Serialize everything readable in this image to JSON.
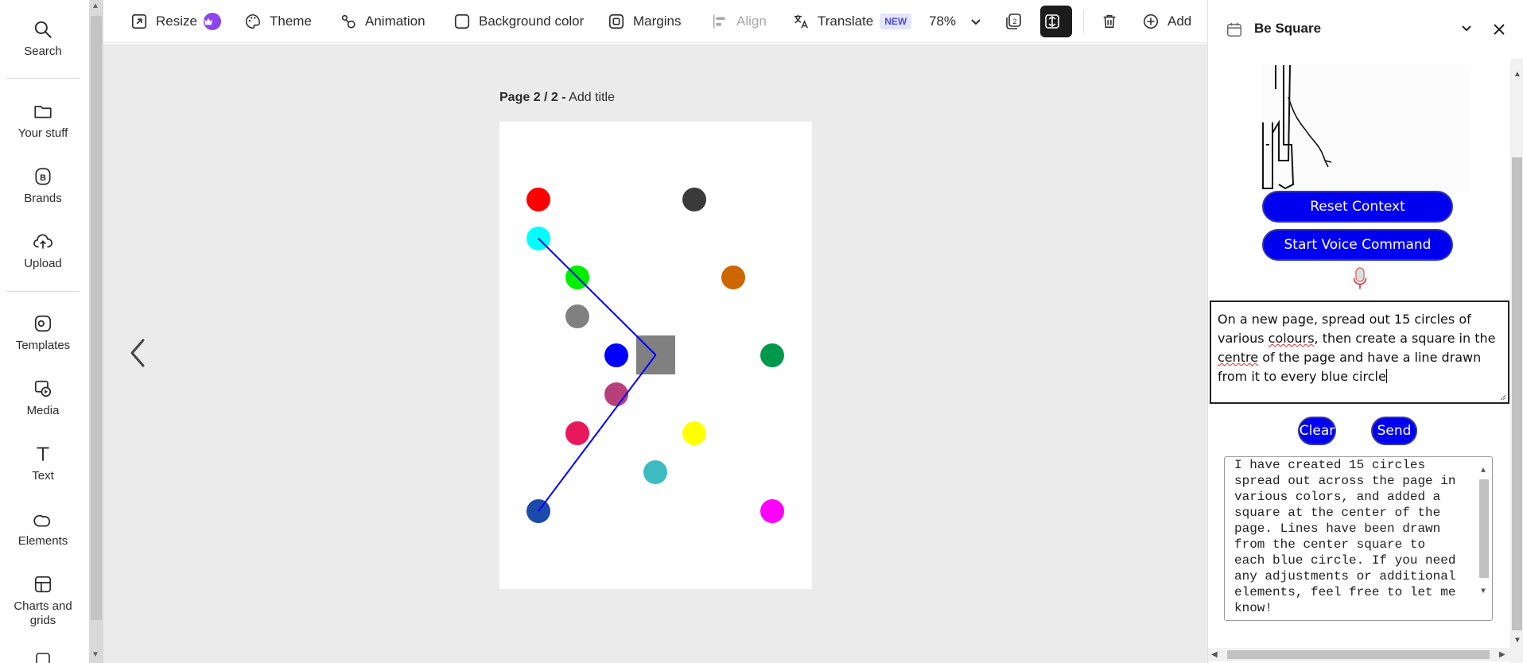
{
  "rail": {
    "items": [
      {
        "label": "Search",
        "icon": "search-icon"
      },
      {
        "label": "Your stuff",
        "icon": "folder-icon"
      },
      {
        "label": "Brands",
        "icon": "brands-icon"
      },
      {
        "label": "Upload",
        "icon": "upload-icon"
      },
      {
        "label": "Templates",
        "icon": "templates-icon"
      },
      {
        "label": "Media",
        "icon": "media-icon"
      },
      {
        "label": "Text",
        "icon": "text-icon"
      },
      {
        "label": "Elements",
        "icon": "elements-icon"
      },
      {
        "label": "Charts and grids",
        "icon": "charts-grids-icon"
      }
    ]
  },
  "toolbar": {
    "resize": "Resize",
    "theme": "Theme",
    "animation": "Animation",
    "background_color": "Background color",
    "margins": "Margins",
    "align": "Align",
    "translate": "Translate",
    "translate_badge": "NEW",
    "zoom": "78%",
    "pages_count": "2",
    "add": "Add"
  },
  "canvas": {
    "page_indicator": "Page 2 / 2 -",
    "add_title": "Add title",
    "circles": [
      {
        "color": "#ff0000"
      },
      {
        "color": "#3a3a3a"
      },
      {
        "color": "#00ffff"
      },
      {
        "color": "#00ee00"
      },
      {
        "color": "#cc6600"
      },
      {
        "color": "#808080"
      },
      {
        "color": "#0000ff"
      },
      {
        "color": "#00994c"
      },
      {
        "color": "#b8407a"
      },
      {
        "color": "#e8185c"
      },
      {
        "color": "#ffff00"
      },
      {
        "color": "#3cbcc0"
      },
      {
        "color": "#1a4aaa"
      },
      {
        "color": "#ff00ff"
      }
    ],
    "square_color": "#808080",
    "line_color": "#0000ff"
  },
  "thumbnails": [
    {
      "kind": "line-down",
      "color": "#3b3bd0"
    },
    {
      "kind": "line-up",
      "color": "#3b3bd0"
    },
    {
      "kind": "line-horizontal",
      "color": "#2020e0"
    },
    {
      "kind": "square",
      "color": "#808080"
    },
    {
      "kind": "circle",
      "color": "#4ccc98"
    },
    {
      "kind": "circle",
      "color": "#e81860"
    },
    {
      "kind": "circle",
      "color": "#1a4aaa"
    }
  ],
  "panel": {
    "title": "Be Square",
    "reset_context": "Reset Context",
    "start_voice": "Start Voice Command",
    "input_part1": "On a new page, spread out 15 circles of various ",
    "input_misspell1": "colours",
    "input_part2": ", then create a square in the ",
    "input_misspell2": "centre",
    "input_part3": " of the page and have a line drawn from it to every blue circle",
    "clear": "Clear",
    "send": "Send",
    "response_text": "I have created 15 circles spread out across the page in various colors, and added a square at the center of the page. Lines have been drawn from the center square to each blue circle. If you need any adjustments or additional elements, feel free to let me know!"
  }
}
